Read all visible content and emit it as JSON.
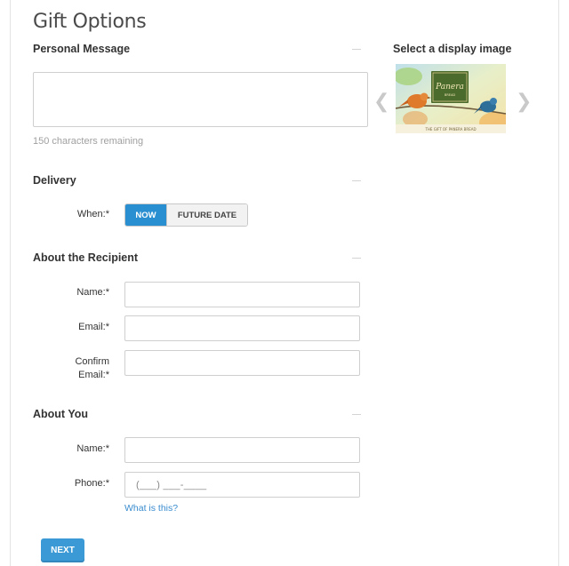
{
  "page": {
    "title": "Gift Options"
  },
  "personal_message": {
    "heading": "Personal Message",
    "textarea_value": "",
    "chars_remaining": "150 characters remaining"
  },
  "display_image": {
    "heading": "Select a display image",
    "card_logo": "Panera",
    "card_logo_sub": "BREAD",
    "card_caption": "THE GIFT OF PANERA BREAD",
    "prev_icon": "chevron-left-icon",
    "next_icon": "chevron-right-icon"
  },
  "delivery": {
    "heading": "Delivery",
    "when_label": "When:*",
    "options": [
      "NOW",
      "FUTURE DATE"
    ],
    "selected": "NOW"
  },
  "recipient": {
    "heading": "About the Recipient",
    "name_label": "Name:*",
    "email_label": "Email:*",
    "confirm_label_1": "Confirm",
    "confirm_label_2": "Email:*",
    "name_value": "",
    "email_value": "",
    "confirm_value": ""
  },
  "about_you": {
    "heading": "About You",
    "name_label": "Name:*",
    "phone_label": "Phone:*",
    "name_value": "",
    "phone_mask": "(___) ___-____",
    "help_link": "What is this?"
  },
  "actions": {
    "next_label": "NEXT"
  },
  "colors": {
    "accent": "#2a8fd1",
    "button": "#3b9ad6",
    "link": "#3a8ccf"
  }
}
